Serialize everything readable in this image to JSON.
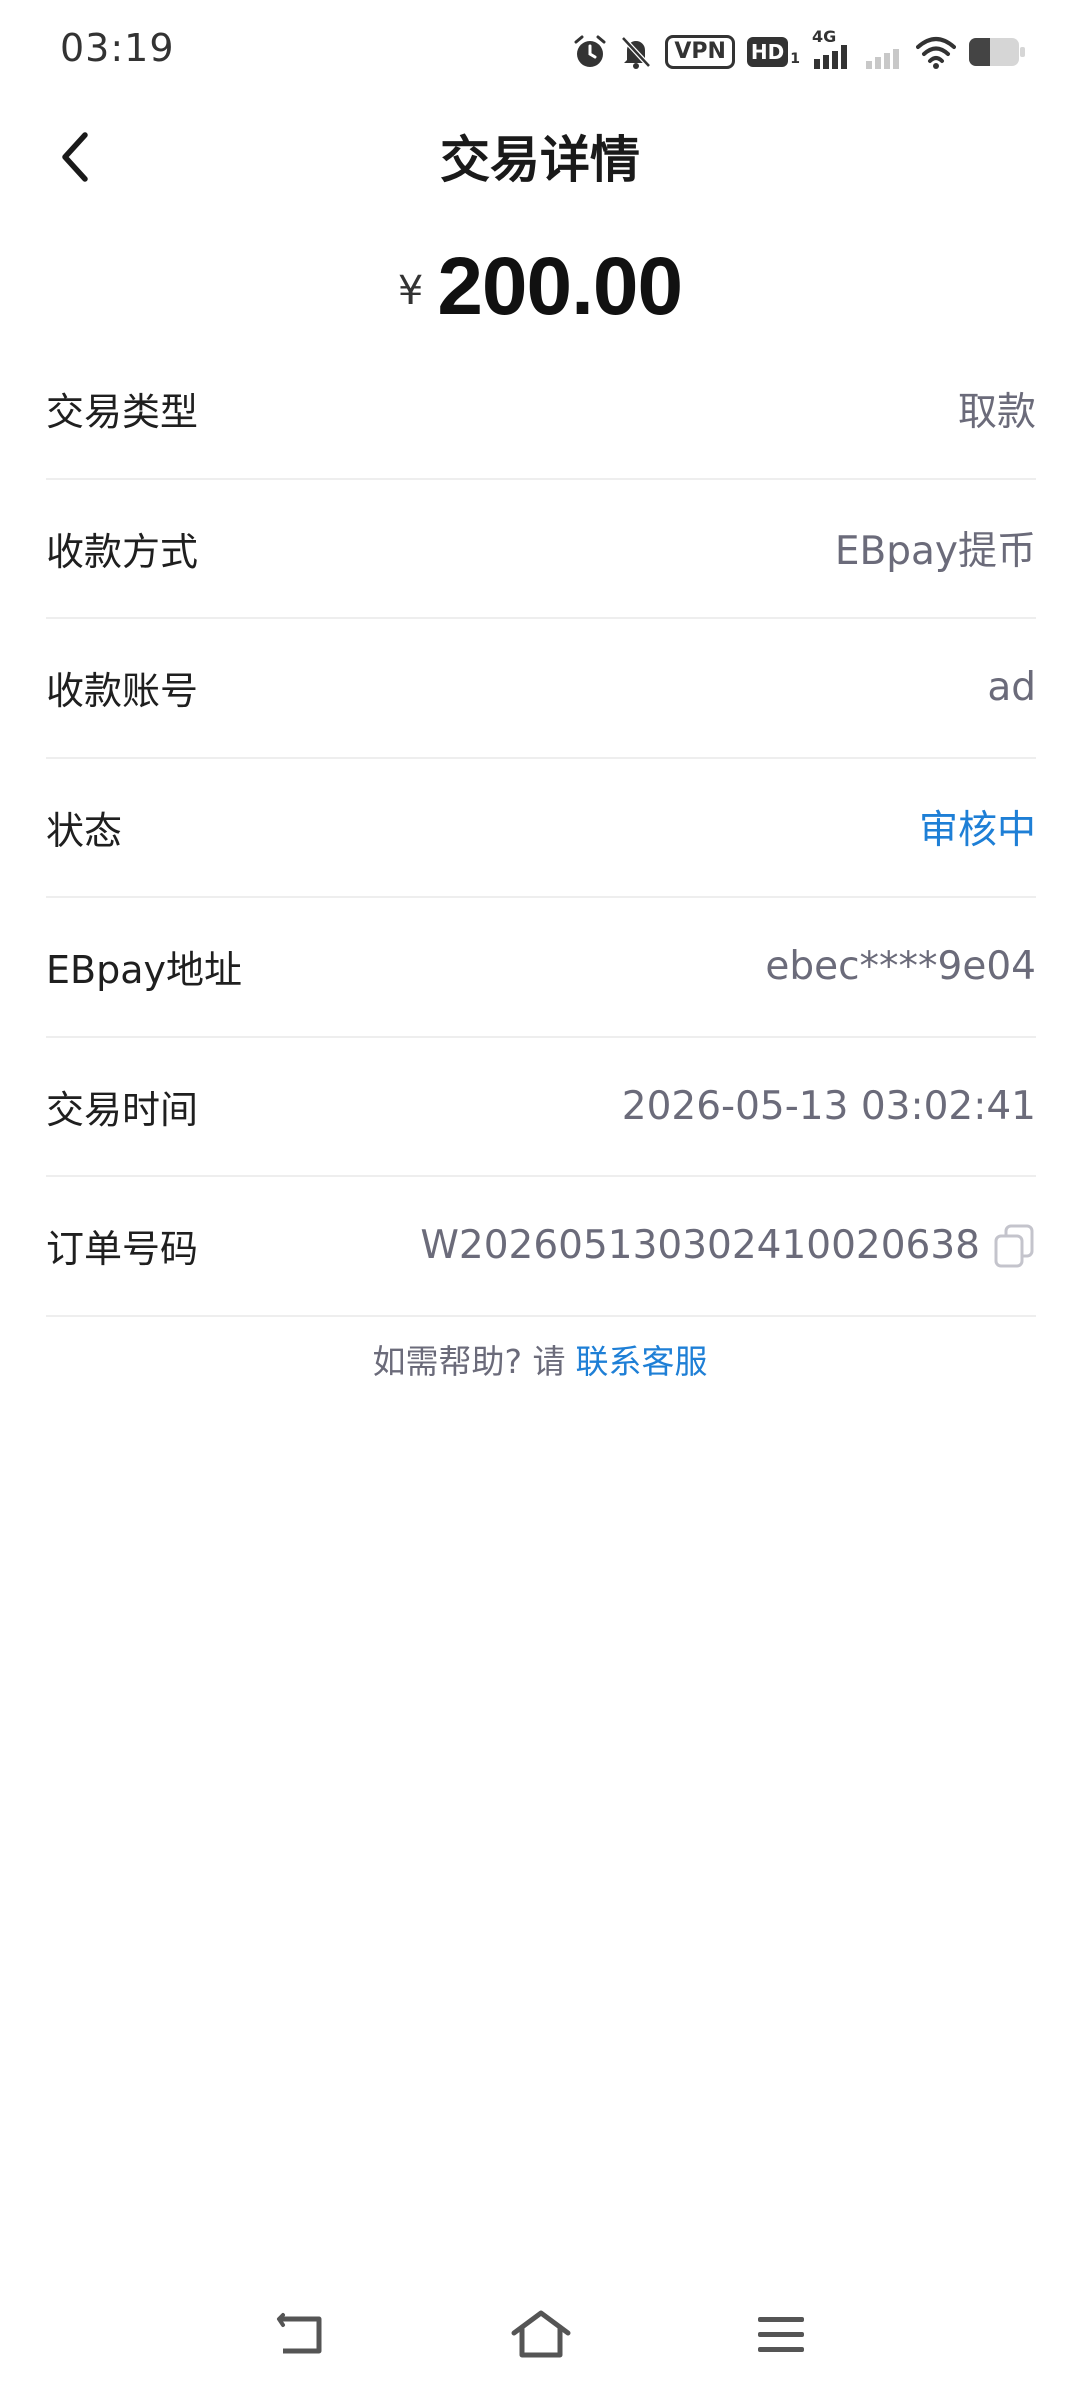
{
  "status_bar": {
    "time": "03:19",
    "vpn": "VPN",
    "hd": "HD",
    "hd_sub": "1",
    "network": "4G"
  },
  "header": {
    "title": "交易详情"
  },
  "amount": {
    "currency": "¥",
    "value": "200.00"
  },
  "details": [
    {
      "label": "交易类型",
      "value": "取款"
    },
    {
      "label": "收款方式",
      "value": "EBpay提币"
    },
    {
      "label": "收款账号",
      "value": "ad"
    },
    {
      "label": "状态",
      "value": "审核中"
    },
    {
      "label": "EBpay地址",
      "value": "ebec****9e04"
    },
    {
      "label": "交易时间",
      "value": "2026-05-13 03:02:41"
    },
    {
      "label": "订单号码",
      "value": "W202605130302410020638"
    }
  ],
  "help": {
    "text": "如需帮助? 请",
    "link": "联系客服"
  },
  "colors": {
    "accent": "#1e7fd6",
    "value_text": "#6b6b7a"
  },
  "icons": {
    "back": "chevron-left-icon",
    "copy": "copy-icon",
    "nav_back": "back-icon",
    "nav_home": "home-icon",
    "nav_menu": "menu-icon"
  }
}
